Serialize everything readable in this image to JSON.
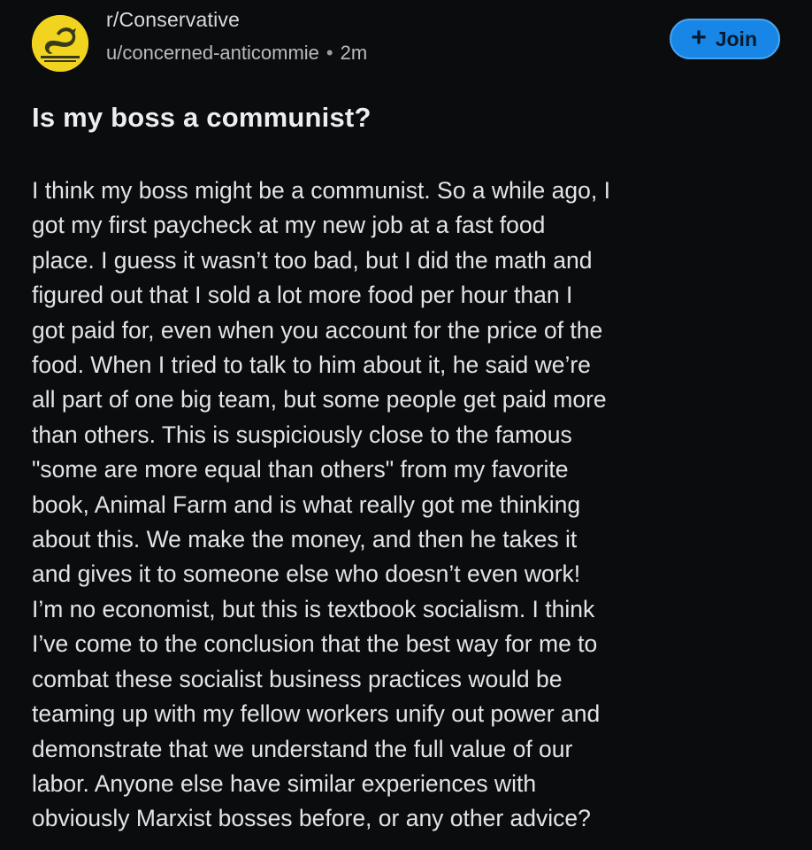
{
  "header": {
    "subreddit": "r/Conservative",
    "username": "u/concerned-anticommie",
    "separator": "•",
    "time_ago": "2m",
    "avatar_icon": "gadsden-flag-icon",
    "join_label": "Join",
    "join_icon": "plus-icon"
  },
  "post": {
    "title": "Is my boss a communist?",
    "body_lines": [
      "I think my boss might be a communist. So a while ago, I",
      "got my first paycheck at my new job at a fast food",
      "place. I guess it wasn’t too bad, but I did the math and",
      "figured out that I sold a lot more food per hour than I",
      "got paid for, even when you account for the price of the",
      "food. When I tried to talk to him about it, he said we’re",
      "all part of one big team, but some people get paid more",
      "than others. This is suspiciously close to the famous",
      "\"some are more equal than others\" from my favorite",
      "book, Animal Farm and is what really got me thinking",
      "about this. We make the money, and then he takes it",
      "and gives it to someone else who doesn’t even work!",
      "I’m no economist, but this is textbook socialism. I think",
      "I’ve come to the conclusion that the best way for me to",
      "combat these socialist business practices would be",
      "teaming up with my fellow workers unify out power and",
      "demonstrate that we understand the full value of our",
      "labor. Anyone else have similar experiences with",
      "obviously Marxist bosses before, or any other advice?"
    ]
  },
  "colors": {
    "background": "#0b0c0d",
    "join_button": "#1786e6",
    "avatar": "#f0d41f"
  }
}
